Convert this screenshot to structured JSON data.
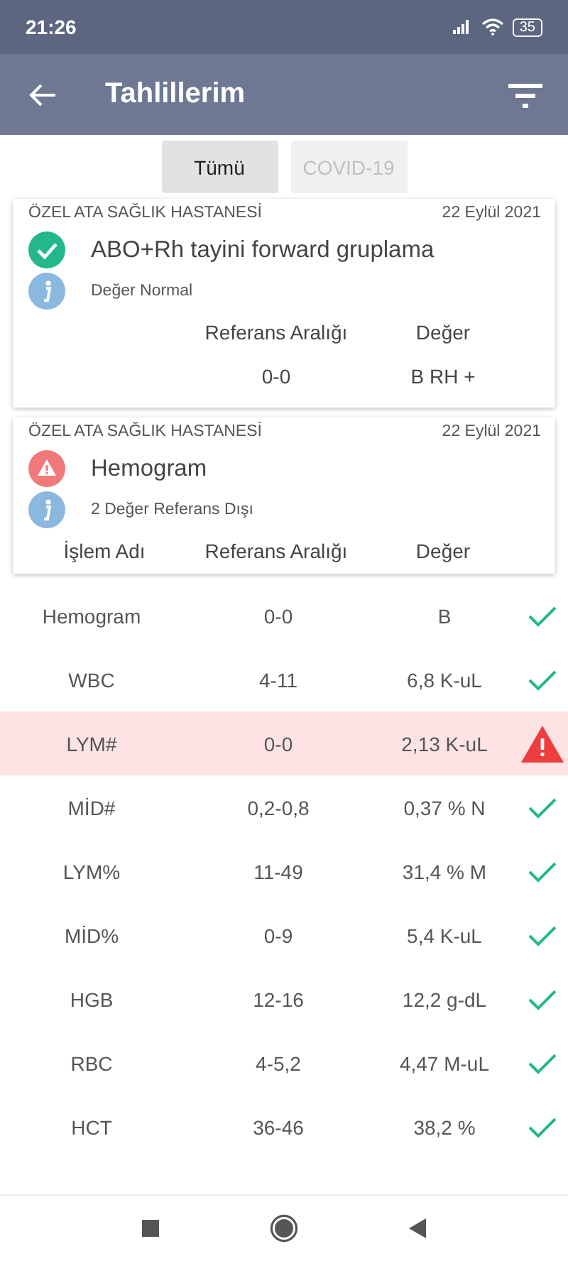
{
  "status_bar": {
    "time": "21:26",
    "battery": "35"
  },
  "app_bar": {
    "title": "Tahlillerim"
  },
  "filters": [
    {
      "label": "Tümü",
      "selected": true
    },
    {
      "label": "COVID-19",
      "selected": false
    }
  ],
  "cards": [
    {
      "hospital": "ÖZEL ATA SAĞLIK HASTANESİ",
      "date": "22 Eylül 2021",
      "kind": "normal",
      "test": "ABO+Rh tayini forward gruplama",
      "note": "Değer Normal",
      "columns": [
        "Referans Aralığı",
        "Değer"
      ],
      "values": [
        "0-0",
        "B RH +"
      ]
    },
    {
      "hospital": "ÖZEL ATA SAĞLIK HASTANESİ",
      "date": "22 Eylül 2021",
      "kind": "warning",
      "test": "Hemogram",
      "note": "2 Değer Referans Dışı",
      "columns": [
        "İşlem Adı",
        "Referans Aralığı",
        "Değer"
      ]
    }
  ],
  "rows": [
    {
      "name": "Hemogram",
      "range": "0-0",
      "value": "B",
      "flagged": false
    },
    {
      "name": "WBC",
      "range": "4-11",
      "value": "6,8 K-uL",
      "flagged": false
    },
    {
      "name": "LYM#",
      "range": "0-0",
      "value": "2,13 K-uL",
      "flagged": true
    },
    {
      "name": "MİD#",
      "range": "0,2-0,8",
      "value": "0,37 % N",
      "flagged": false
    },
    {
      "name": "LYM%",
      "range": "11-49",
      "value": "31,4 % M",
      "flagged": false
    },
    {
      "name": "MİD%",
      "range": "0-9",
      "value": "5,4 K-uL",
      "flagged": false
    },
    {
      "name": "HGB",
      "range": "12-16",
      "value": "12,2 g-dL",
      "flagged": false
    },
    {
      "name": "RBC",
      "range": "4-5,2",
      "value": "4,47 M-uL",
      "flagged": false
    },
    {
      "name": "HCT",
      "range": "36-46",
      "value": "38,2 %",
      "flagged": false
    }
  ]
}
